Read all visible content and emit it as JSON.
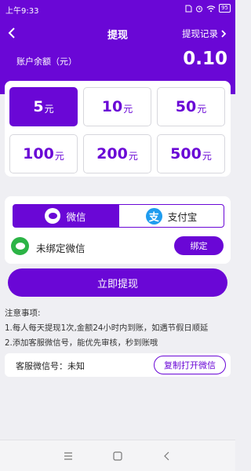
{
  "status_bar": {
    "time": "上午9:33",
    "battery": "95"
  },
  "header": {
    "title": "提现",
    "record_link": "提现记录"
  },
  "balance": {
    "label": "账户余额（元）",
    "value": "0.10"
  },
  "amount_options": [
    {
      "amount": "5",
      "unit": "元",
      "selected": true
    },
    {
      "amount": "10",
      "unit": "元",
      "selected": false
    },
    {
      "amount": "50",
      "unit": "元",
      "selected": false
    },
    {
      "amount": "100",
      "unit": "元",
      "selected": false
    },
    {
      "amount": "200",
      "unit": "元",
      "selected": false
    },
    {
      "amount": "500",
      "unit": "元",
      "selected": false
    }
  ],
  "payment": {
    "wechat_tab": "微信",
    "alipay_tab": "支付宝",
    "alipay_glyph": "支",
    "bind_status": "未绑定微信",
    "bind_button": "绑定"
  },
  "submit_button": "立即提现",
  "notes": {
    "heading": "注意事项:",
    "line1": "1.每人每天提现1次,金额24小时内到账，如遇节假日顺延",
    "line2": "2.添加客服微信号，能优先审核，秒到账哦"
  },
  "service": {
    "label": "客服微信号：未知",
    "copy_button": "复制打开微信"
  },
  "colors": {
    "primary": "#6a07d6",
    "wechat_green": "#2cb446",
    "alipay_blue": "#1f9cef"
  }
}
